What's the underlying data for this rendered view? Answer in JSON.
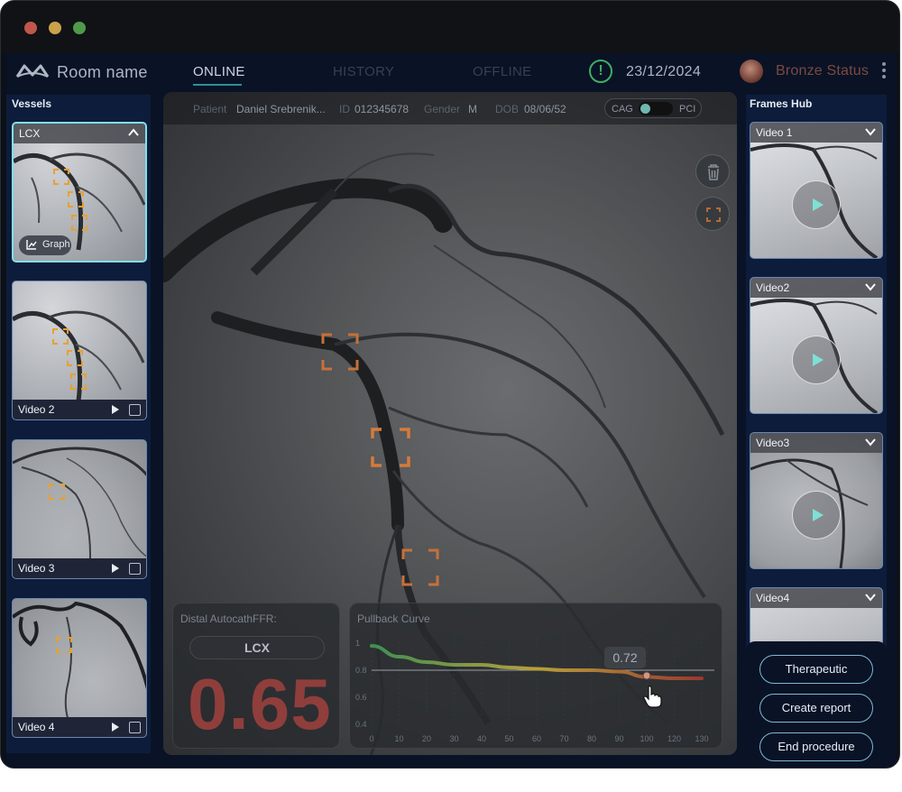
{
  "window": {
    "dots": [
      "#c0564c",
      "#c9a24a",
      "#4f9a4a"
    ]
  },
  "navbar": {
    "room_name": "Room name",
    "tabs": [
      {
        "label": "ONLINE",
        "active": true
      },
      {
        "label": "HISTORY",
        "active": false
      },
      {
        "label": "OFFLINE",
        "active": false
      }
    ],
    "alert_icon": "!",
    "date": "23/12/2024",
    "status": "Bronze Status"
  },
  "vessels": {
    "title": "Vessels",
    "items": [
      {
        "label": "LCX",
        "selected": true,
        "graph_label": "Graph"
      },
      {
        "label": "Video 2"
      },
      {
        "label": "Video 3"
      },
      {
        "label": "Video 4"
      }
    ]
  },
  "patient": {
    "patient_key": "Patient",
    "patient_name": "Daniel Srebrenik...",
    "id_key": "ID",
    "id_value": "012345678",
    "gender_key": "Gender",
    "gender_value": "M",
    "dob_key": "DOB",
    "dob_value": "08/06/52",
    "mode_left": "CAG",
    "mode_right": "PCI"
  },
  "ffr": {
    "title": "Distal AutocathFFR:",
    "vessel": "LCX",
    "value": "0.65",
    "value_color": "#8f3e3c"
  },
  "pullback": {
    "title": "Pullback Curve",
    "tooltip": "0.72"
  },
  "chart_data": {
    "type": "line",
    "title": "Pullback Curve",
    "x_ticks": [
      "0",
      "10",
      "20",
      "30",
      "40",
      "50",
      "60",
      "70",
      "80",
      "90",
      "100",
      "120",
      "130"
    ],
    "y_ticks": [
      "1",
      "0.8",
      "0.6",
      "0.4"
    ],
    "ylim": [
      0.4,
      1.0
    ],
    "threshold": 0.8,
    "series": [
      {
        "x": [
          0,
          10,
          20,
          30,
          40,
          50,
          60,
          70,
          80,
          90,
          100,
          120,
          130
        ],
        "values": [
          0.98,
          0.9,
          0.86,
          0.84,
          0.84,
          0.82,
          0.81,
          0.8,
          0.8,
          0.79,
          0.75,
          0.74,
          0.74
        ]
      }
    ],
    "gradient_colors": [
      "#3f8f52",
      "#b7a03a",
      "#9a3a30"
    ]
  },
  "frames_hub": {
    "title": "Frames Hub",
    "items": [
      {
        "label": "Video 1"
      },
      {
        "label": "Video2"
      },
      {
        "label": "Video3"
      },
      {
        "label": "Video4"
      }
    ]
  },
  "actions": {
    "therapeutic": "Therapeutic",
    "create_report": "Create report",
    "end_procedure": "End procedure"
  },
  "colors": {
    "accent": "#7fe0ea",
    "marker": "#e8a030",
    "marker_main": "#c7703a"
  }
}
